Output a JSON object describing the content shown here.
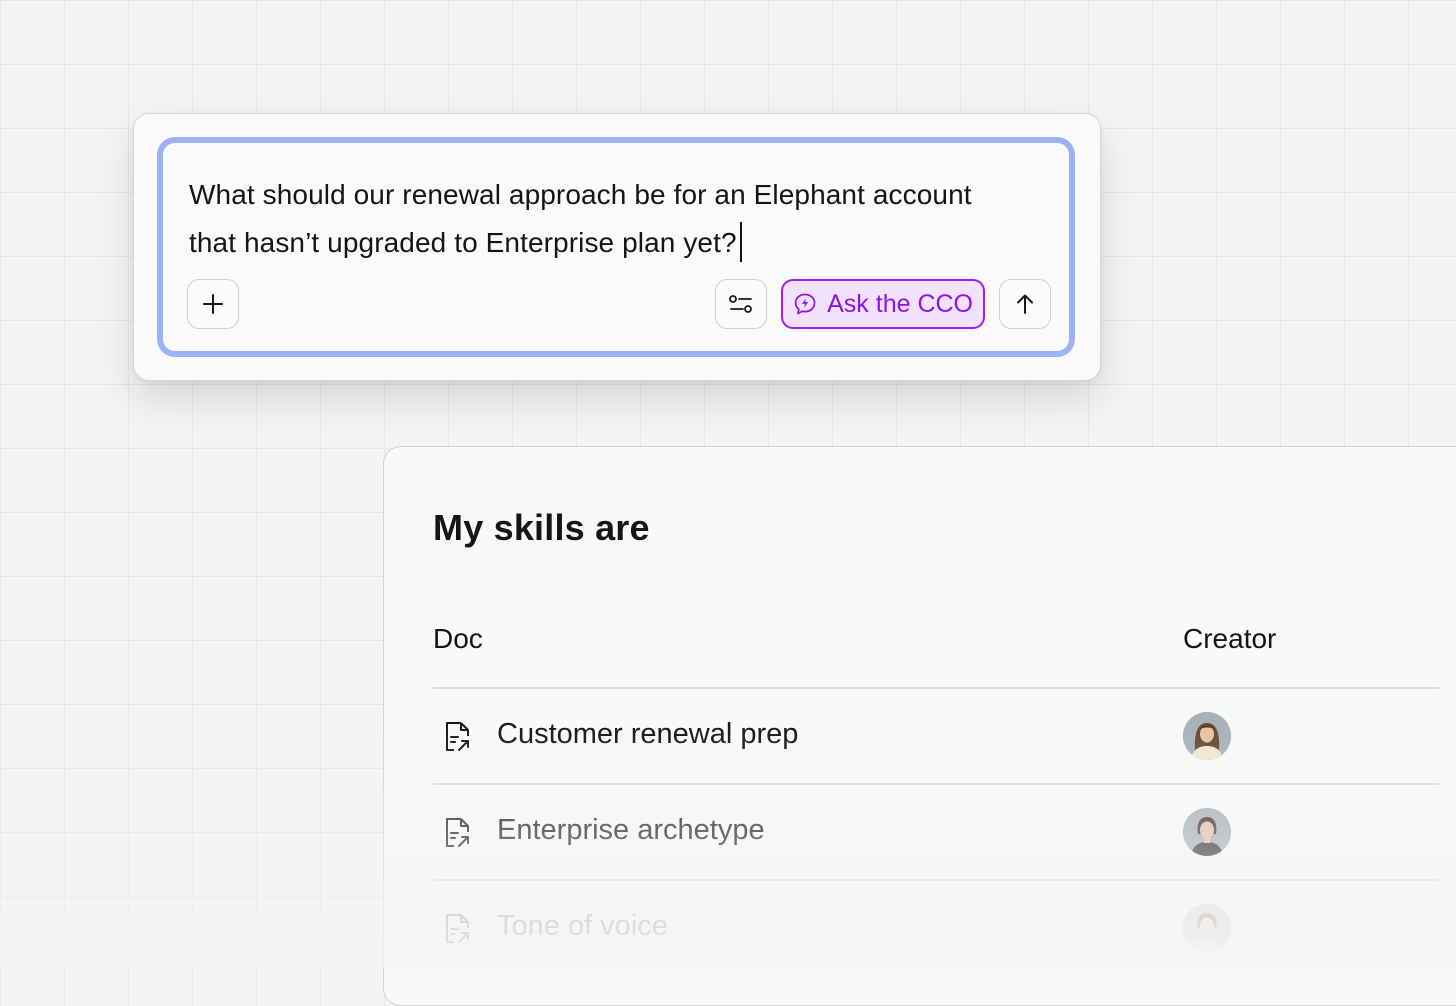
{
  "prompt": {
    "line1": "What should our renewal approach be for an Elephant account",
    "line2": "that hasn’t upgraded to Enterprise plan yet?",
    "ask_label": "Ask the CCO",
    "icons": {
      "add": "plus-icon",
      "settings": "sliders-icon",
      "ask": "chat-bubble-bolt-icon",
      "send": "arrow-up-icon"
    },
    "colors": {
      "focus_ring": "#9bb2f5",
      "accent": "#8f12e8",
      "accent_bg": "#f3e2fe"
    }
  },
  "skills": {
    "title": "My skills are",
    "columns": {
      "doc": "Doc",
      "creator": "Creator"
    },
    "rows": [
      {
        "label": "Customer renewal prep",
        "icon": "document-link-icon",
        "avatar": "avatar-woman-long-hair"
      },
      {
        "label": "Enterprise archetype",
        "icon": "document-link-icon",
        "avatar": "avatar-woman-dark-top"
      },
      {
        "label": "Tone of voice",
        "icon": "document-link-icon",
        "avatar": "avatar-woman-light-top"
      }
    ]
  }
}
